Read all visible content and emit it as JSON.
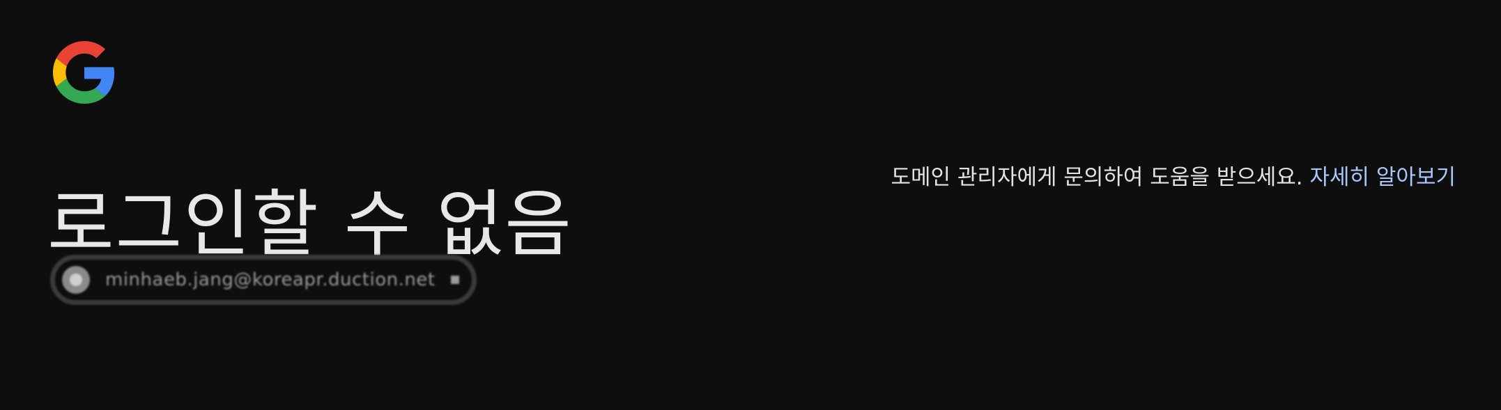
{
  "header": {
    "logo_icon": "google-g-logo-icon",
    "logo_colors": {
      "red": "#EA4335",
      "yellow": "#FBBC05",
      "green": "#34A853",
      "blue": "#4285F4"
    }
  },
  "main": {
    "title": "로그인할 수 없음",
    "account_chip": {
      "avatar_icon": "account-circle-icon",
      "email": "minhaeb.jang@koreapr.duction.net",
      "chevron_icon": "chevron-down-icon",
      "blurred": true
    }
  },
  "message": {
    "text": "도메인 관리자에게 문의하여 도움을 받으세요.",
    "learn_more_label": "자세히 알아보기",
    "link_color": "#a8c7fa"
  },
  "theme": {
    "background": "#0e0e0e",
    "text": "#e3e3e3"
  }
}
